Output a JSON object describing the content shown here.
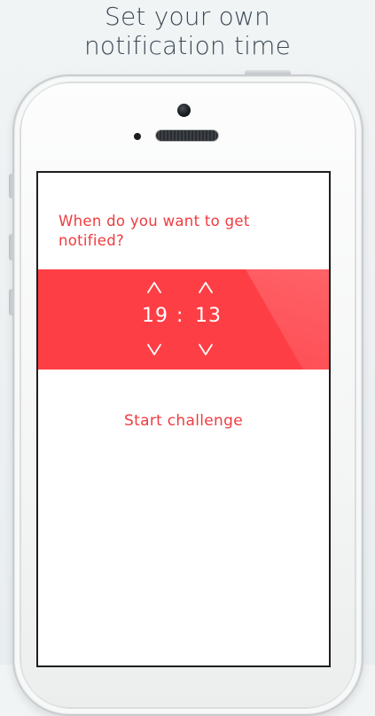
{
  "headline": {
    "line1": "Set your own",
    "line2": "notification time"
  },
  "screen": {
    "question": "When do you want to get notified?",
    "time_picker": {
      "hour": "19",
      "separator": ":",
      "minute": "13",
      "up_icon": "chevron-up-icon",
      "down_icon": "chevron-down-icon"
    },
    "start_label": "Start challenge"
  },
  "colors": {
    "accent": "#fe3e45",
    "text_accent": "#ee3c40",
    "headline": "#3c4a57",
    "background": "#eef2f3"
  }
}
